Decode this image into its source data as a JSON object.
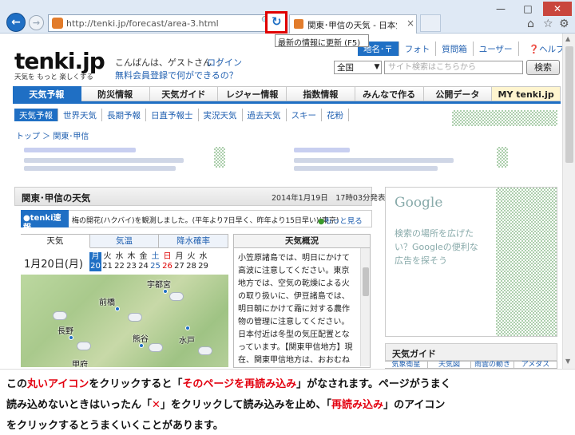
{
  "browser": {
    "url": "http://tenki.jp/forecast/area-3.html",
    "tab_title": "関東･甲信の天気 - 日本気...",
    "tooltip": "最新の情報に更新 (F5)",
    "refresh_icon": "↻",
    "back_icon": "←",
    "forward_icon": "→",
    "win_min": "—",
    "win_max": "□",
    "win_close": "✕"
  },
  "header": {
    "logo": "tenki.jp",
    "logo_sub": "天気を もっと 楽しくする",
    "greeting": "こんばんは、ゲストさん ｜",
    "login": "ログイン",
    "free_reg": "無料会員登録で何ができるの？",
    "top_links": [
      "地名･〒",
      "フォト",
      "質問箱",
      "ユーザー"
    ],
    "help": "ヘルプ",
    "search_scope": "全国",
    "search_placeholder": "サイト検索はこちらから",
    "search_button": "検索"
  },
  "gnav": [
    "天気予報",
    "防災情報",
    "天気ガイド",
    "レジャー情報",
    "指数情報",
    "みんなで作る",
    "公開データ",
    "MY tenki.jp"
  ],
  "subnav": [
    "天気予報",
    "世界天気",
    "長期予報",
    "日直予報士",
    "実況天気",
    "過去天気",
    "スキー",
    "花粉"
  ],
  "breadcrumb": "トップ ＞ 関東･甲信",
  "panel": {
    "title": "関東･甲信の天気",
    "date": "2014年1月19日　17時03分発表",
    "flash_badge": "tenki速報",
    "flash_text": "梅の開花(ハクバイ)を観測しました。(平年より7日早く、昨年より15日早い)(東京)",
    "flash_more": "もっと見る",
    "tabs": [
      "天気",
      "気温",
      "降水確率"
    ],
    "forecast_date": "1月20日(月)",
    "days": [
      {
        "w": "月",
        "d": "20"
      },
      {
        "w": "火",
        "d": "21"
      },
      {
        "w": "水",
        "d": "22"
      },
      {
        "w": "木",
        "d": "23"
      },
      {
        "w": "金",
        "d": "24"
      },
      {
        "w": "土",
        "d": "25"
      },
      {
        "w": "日",
        "d": "26"
      },
      {
        "w": "月",
        "d": "27"
      },
      {
        "w": "火",
        "d": "28"
      },
      {
        "w": "水",
        "d": "29"
      }
    ],
    "cities": [
      "宇都宮",
      "前橋",
      "長野",
      "熊谷",
      "水戸",
      "甲府"
    ],
    "outlook_title": "天気概況",
    "outlook_text": "小笠原諸島では、明日にかけて高波に注意してください。東京地方では、空気の乾燥による火の取り扱いに、伊豆諸島では、明日朝にかけて霜に対する農作物の管理に注意してください。日本付近は冬型の気圧配置となっています。【関東甲信地方】現在、関東甲信地方は、おおむね晴れていますが、"
  },
  "sidebar": {
    "ad_logo": "Google",
    "ad_text": "検索の場所を広げたい？Googleの便利な広告を探そう",
    "guide_title": "天気ガイド",
    "guide_tabs": [
      "気象衛星",
      "天気図",
      "雨雲の動き",
      "アメダス"
    ]
  },
  "caption": {
    "l1a": "この",
    "l1b": "丸いアイコン",
    "l1c": "をクリックすると「",
    "l1d": "そのページを再読み込み",
    "l1e": "」がなされます。ページがうまく",
    "l2a": "読み込めないときはいったん「",
    "l2b": "✕",
    "l2c": "」をクリックして読み込みを止め、「",
    "l2d": "再読み込み",
    "l2e": "」のアイコン",
    "l3": "をクリックするとうまくいくことがあります。"
  }
}
